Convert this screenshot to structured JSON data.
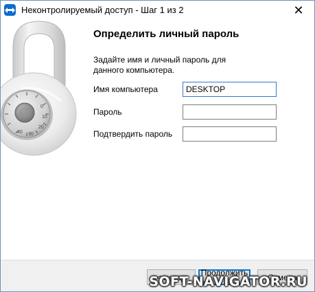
{
  "window": {
    "title": "Неконтролируемый доступ - Шаг 1 из 2",
    "close_glyph": "✕"
  },
  "icons": {
    "app": "teamviewer-icon",
    "illustration": "padlock-icon",
    "close": "close-icon"
  },
  "page": {
    "heading": "Определить личный пароль",
    "description": "Задайте имя и личный пароль для данного компьютера."
  },
  "form": {
    "computer_name_label": "Имя компьютера",
    "computer_name_value": "DESKTOP",
    "password_label": "Пароль",
    "password_value": "",
    "confirm_label": "Подтвердить пароль",
    "confirm_value": ""
  },
  "buttons": {
    "back": "< назад",
    "next": "Продолжить >",
    "cancel": "Отмена"
  },
  "watermark": "SOFT-NAVIGATOR.RU",
  "lock_dial_numbers": [
    "0",
    "10",
    "20",
    "30",
    "40"
  ],
  "colors": {
    "accent": "#0078d7",
    "app_icon": "#0e6bd0",
    "footer_bg": "#f0f0f0"
  }
}
